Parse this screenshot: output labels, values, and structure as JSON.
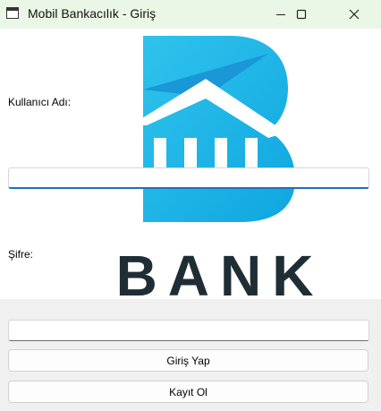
{
  "window": {
    "title": "Mobil Bankacılık - Giriş"
  },
  "logo": {
    "text": "BANK",
    "accent_color": "#1fb6e8",
    "text_color": "#1f2d35"
  },
  "form": {
    "username_label": "Kullanıcı Adı:",
    "username_value": "",
    "password_label": "Şifre:",
    "password_value": ""
  },
  "buttons": {
    "login_label": "Giriş Yap",
    "register_label": "Kayıt Ol"
  }
}
